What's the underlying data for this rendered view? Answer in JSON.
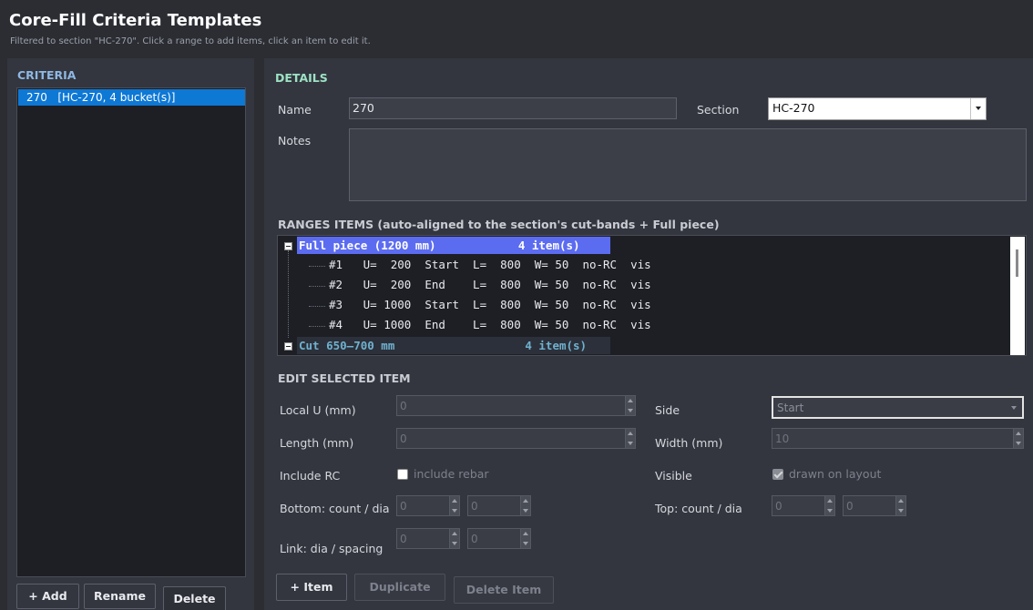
{
  "header": {
    "title": "Core-Fill Criteria Templates",
    "subtitle": "Filtered to section \"HC-270\". Click a range to add items, click an item to edit it."
  },
  "criteria": {
    "heading": "CRITERIA",
    "items": [
      {
        "label": "270   [HC-270, 4 bucket(s)]",
        "selected": true
      }
    ],
    "buttons": {
      "add": "+ Add",
      "rename": "Rename",
      "delete": "Delete"
    }
  },
  "details": {
    "heading": "DETAILS",
    "name_label": "Name",
    "name_value": "270",
    "section_label": "Section",
    "section_value": "HC-270",
    "notes_label": "Notes",
    "notes_value": ""
  },
  "ranges": {
    "heading": "RANGES  ITEMS  (auto-aligned to the section's cut-bands + Full piece)",
    "groups": [
      {
        "label": "Full piece (1200 mm)            4 item(s)",
        "expanded": true,
        "items": [
          "#1   U=  200  Start  L=  800  W= 50  no-RC  vis",
          "#2   U=  200  End    L=  800  W= 50  no-RC  vis",
          "#3   U= 1000  Start  L=  800  W= 50  no-RC  vis",
          "#4   U= 1000  End    L=  800  W= 50  no-RC  vis"
        ]
      },
      {
        "label": "Cut 650–700 mm                   4 item(s)",
        "expanded": true,
        "items": []
      }
    ]
  },
  "edit": {
    "heading": "EDIT SELECTED ITEM",
    "local_u_label": "Local U (mm)",
    "local_u_value": "0",
    "side_label": "Side",
    "side_value": "Start",
    "length_label": "Length (mm)",
    "length_value": "0",
    "width_label": "Width (mm)",
    "width_value": "10",
    "include_rc_label": "Include RC",
    "include_rebar_text": "include rebar",
    "include_rebar_checked": false,
    "visible_label": "Visible",
    "drawn_on_layout_text": "drawn on layout",
    "drawn_on_layout_checked": true,
    "bottom_label": "Bottom: count / dia",
    "bottom_count": "0",
    "bottom_dia": "0",
    "top_label": "Top: count / dia",
    "top_count": "0",
    "top_dia": "0",
    "link_label": "Link: dia / spacing",
    "link_dia": "0",
    "link_spacing": "0"
  },
  "actions": {
    "item": "+ Item",
    "duplicate": "Duplicate",
    "delete_item": "Delete Item"
  }
}
